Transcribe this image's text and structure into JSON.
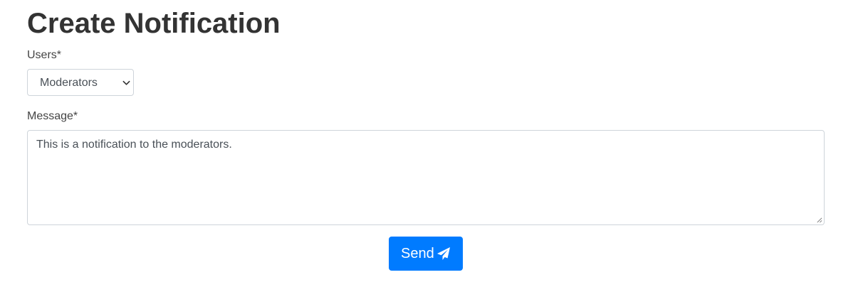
{
  "page": {
    "title": "Create Notification"
  },
  "form": {
    "users_label": "Users*",
    "users_selected": "Moderators",
    "message_label": "Message*",
    "message_value": "This is a notification to the moderators.",
    "send_label": "Send",
    "send_icon": "paper-plane-icon"
  },
  "colors": {
    "primary": "#007bff",
    "text": "#333333",
    "border": "#ced4da"
  }
}
